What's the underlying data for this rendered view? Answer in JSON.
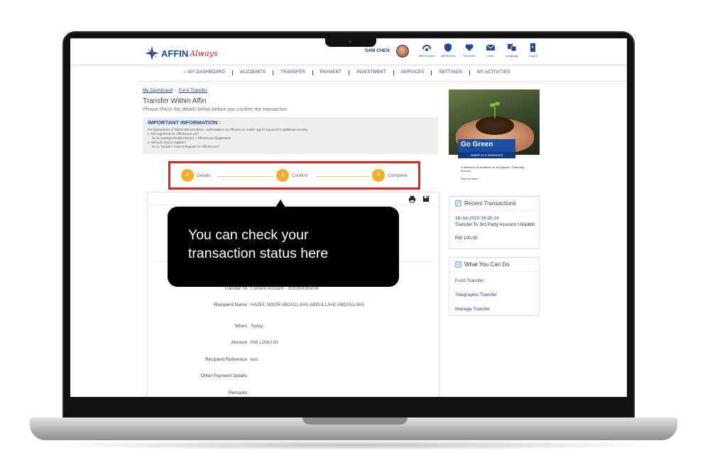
{
  "header": {
    "logo_text": "AFFIN",
    "logo_tagline": "Always",
    "user_name": "SAM CHEN",
    "icons": [
      {
        "label": "AffinConnect",
        "icon": "connect-icon"
      },
      {
        "label": "AffinSecure",
        "icon": "shield-icon"
      },
      {
        "label": "Favourite",
        "icon": "heart-icon"
      },
      {
        "label": "Inbox",
        "icon": "mail-icon"
      },
      {
        "label": "Language",
        "icon": "language-icon"
      },
      {
        "label": "Logout",
        "icon": "logout-icon"
      }
    ]
  },
  "nav": [
    "MY DASHBOARD",
    "ACCOUNTS",
    "TRANSFER",
    "PAYMENT",
    "INVESTMENT",
    "SERVICES",
    "SETTINGS",
    "MY ACTIVITIES"
  ],
  "breadcrumb": [
    "My Dashboard",
    "Fund Transfer"
  ],
  "page": {
    "title": "Transfer Within Affin",
    "subtitle": "Please check the details below before you confirm the transaction"
  },
  "info": {
    "title": "IMPORTANT INFORMATION :",
    "lines": [
      "For transactions of RM10,000 and above, authorisation via AffinSecure mobile app is required for additional security.",
      "1. Not registered for AffinSecure yet?",
      "Go to Settings (Profile Picture) > AffinSecure Registration",
      "2. Not sure how to register?",
      "Go to Tutorial > How to Register for AffinSecure?"
    ]
  },
  "stepper": [
    {
      "num": "1",
      "label": "Details"
    },
    {
      "num": "2",
      "label": "Confirm"
    },
    {
      "num": "3",
      "label": "Complete"
    }
  ],
  "tooltip": {
    "text": "You can check your transaction status here"
  },
  "details": [
    {
      "label": "Transfer To",
      "value": "Current Account - 100260005004"
    },
    {
      "label": "Recipient Name",
      "value": "HAZEL NOOR ABDULLAH1 ABDULLAH2 ABDULLAH3"
    },
    {
      "label": "When",
      "value": "Today"
    },
    {
      "label": "Amount",
      "value": "RM 12000.00"
    },
    {
      "label": "Recipient Reference",
      "value": "test"
    },
    {
      "label": "Other Payment Details",
      "value": ""
    },
    {
      "label": "Remarks",
      "value": ""
    }
  ],
  "promo": {
    "title": "Go Green",
    "subtitle": "Switch to e-Statement",
    "note": "e-Statement is available for all Deposit / Financing Account",
    "more": "Find out more >"
  },
  "recent": {
    "title": "Recent Transactions",
    "date": "18-Jul-2022 16:25:14",
    "desc": "Transfer To 3rd Party Account / Afaddin",
    "amount": "RM 100.00"
  },
  "what_you_can_do": {
    "title": "What You Can Do",
    "links": [
      "Fund Transfer",
      "Telegraphic Transfer",
      "Manage Transfer"
    ]
  },
  "colors": {
    "brand": "#1b4a9c",
    "accent": "#f3ad2c",
    "highlight": "#e81e1e"
  }
}
